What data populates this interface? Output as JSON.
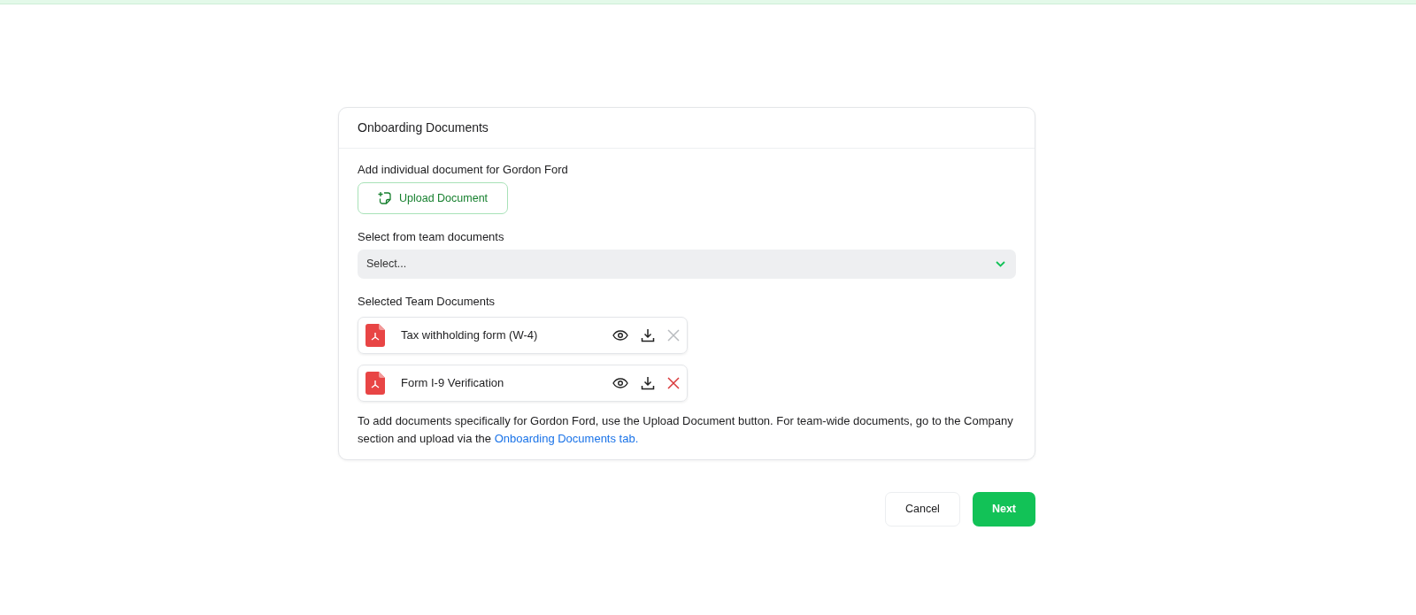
{
  "card": {
    "title": "Onboarding Documents",
    "individual": {
      "label": "Add individual document for Gordon Ford",
      "button": "Upload Document"
    },
    "team_select": {
      "label": "Select from team documents",
      "placeholder": "Select..."
    },
    "selected_label": "Selected Team Documents",
    "documents": [
      {
        "name": "Tax withholding form (W-4)",
        "remove_disabled": true
      },
      {
        "name": "Form I-9 Verification",
        "remove_disabled": false
      }
    ],
    "note": {
      "text": "To add documents specifically for Gordon Ford, use the Upload Document button. For team-wide documents, go to the Company section and upload via the ",
      "link": "Onboarding Documents tab."
    }
  },
  "buttons": [
    {
      "label": "Cancel",
      "kind": "secondary"
    },
    {
      "label": "Next",
      "kind": "primary"
    }
  ]
}
